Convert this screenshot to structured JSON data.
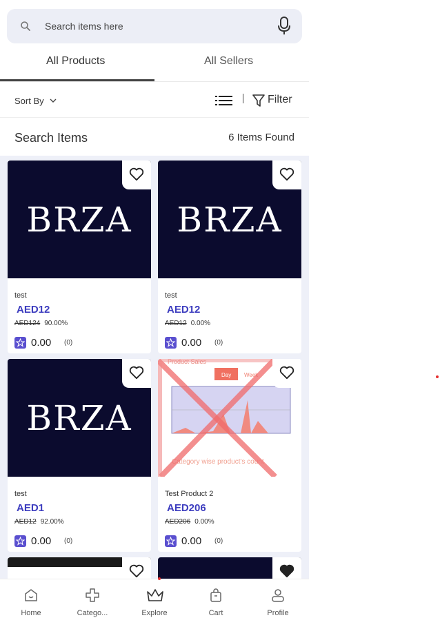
{
  "search": {
    "placeholder": "Search items here",
    "icon": "search-icon",
    "voice_icon": "mic-icon"
  },
  "tabs": [
    {
      "label": "All Products",
      "active": true
    },
    {
      "label": "All Sellers",
      "active": false
    }
  ],
  "toolbar": {
    "sort_label": "Sort By",
    "filter_label": "Filter",
    "view_icon": "list-view-icon",
    "filter_icon": "funnel-icon"
  },
  "results": {
    "title": "Search Items",
    "count_text": "6 Items Found"
  },
  "products": [
    {
      "name": "test",
      "price": "AED12",
      "original_price": "AED124",
      "discount": "90.00%",
      "rating": "0.00",
      "reviews": "(0)",
      "image": "BRZA",
      "favorite": false
    },
    {
      "name": "test",
      "price": "AED12",
      "original_price": "AED12",
      "discount": "0.00%",
      "rating": "0.00",
      "reviews": "(0)",
      "image": "BRZA",
      "favorite": false
    },
    {
      "name": "test",
      "price": "AED1",
      "original_price": "AED12",
      "discount": "92.00%",
      "rating": "0.00",
      "reviews": "(0)",
      "image": "BRZA",
      "favorite": false
    },
    {
      "name": "Test Product 2",
      "price": "AED206",
      "original_price": "AED206",
      "discount": "0.00%",
      "rating": "0.00",
      "reviews": "(0)",
      "image": "chart screenshot",
      "favorite": false,
      "image_text": {
        "title": "Product Sales",
        "button_day": "Day",
        "button_week": "Week",
        "caption": "Category wise product's count"
      }
    }
  ],
  "bottom_nav": [
    {
      "label": "Home",
      "icon": "home-icon"
    },
    {
      "label": "Catego...",
      "icon": "categories-icon"
    },
    {
      "label": "Explore",
      "icon": "crown-icon",
      "active": true
    },
    {
      "label": "Cart",
      "icon": "cart-icon"
    },
    {
      "label": "Profile",
      "icon": "profile-icon"
    }
  ],
  "colors": {
    "accent": "#3d3dbf",
    "star_badge": "#5a4fcf",
    "image_bg": "#0b0b2e",
    "grid_bg": "#eef0f8",
    "search_bg": "#eceef6"
  }
}
